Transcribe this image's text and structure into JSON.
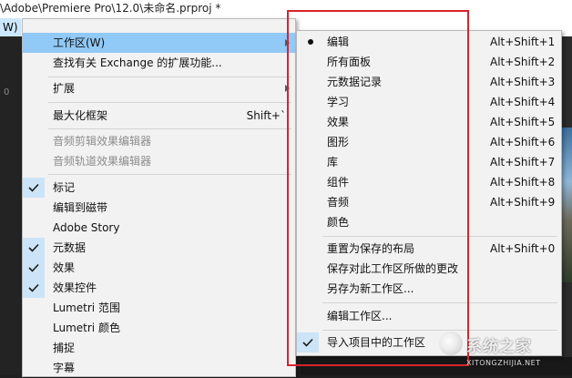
{
  "window": {
    "title": "\\Adobe\\Premiere Pro\\12.0\\未命名.prproj *",
    "menu_label": "W)"
  },
  "background": {
    "left_number": "0"
  },
  "menu": {
    "items": [
      {
        "label": "工作区(W)",
        "shortcut": "",
        "submenu": true,
        "state": "highlight"
      },
      {
        "label": "查找有关 Exchange 的扩展功能...",
        "shortcut": ""
      },
      {
        "label": "扩展",
        "shortcut": "",
        "submenu": true
      },
      {
        "label": "最大化框架",
        "shortcut": "Shift+`"
      },
      {
        "label": "音频剪辑效果编辑器",
        "disabled": true
      },
      {
        "label": "音频轨道效果编辑器",
        "disabled": true
      },
      {
        "label": "标记",
        "checked": true
      },
      {
        "label": "编辑到磁带"
      },
      {
        "label": "Adobe Story"
      },
      {
        "label": "元数据",
        "checked": true
      },
      {
        "label": "效果",
        "checked": true
      },
      {
        "label": "效果控件",
        "checked": true
      },
      {
        "label": "Lumetri 范围"
      },
      {
        "label": "Lumetri 颜色"
      },
      {
        "label": "捕捉"
      },
      {
        "label": "字幕"
      }
    ]
  },
  "submenu": {
    "items": [
      {
        "label": "编辑",
        "shortcut": "Alt+Shift+1",
        "selected": true
      },
      {
        "label": "所有面板",
        "shortcut": "Alt+Shift+2"
      },
      {
        "label": "元数据记录",
        "shortcut": "Alt+Shift+3"
      },
      {
        "label": "学习",
        "shortcut": "Alt+Shift+4"
      },
      {
        "label": "效果",
        "shortcut": "Alt+Shift+5"
      },
      {
        "label": "图形",
        "shortcut": "Alt+Shift+6"
      },
      {
        "label": "库",
        "shortcut": "Alt+Shift+7"
      },
      {
        "label": "组件",
        "shortcut": "Alt+Shift+8"
      },
      {
        "label": "音频",
        "shortcut": "Alt+Shift+9"
      },
      {
        "label": "颜色",
        "shortcut": ""
      },
      {
        "label": "重置为保存的布局",
        "shortcut": "Alt+Shift+0"
      },
      {
        "label": "保存对此工作区所做的更改",
        "shortcut": ""
      },
      {
        "label": "另存为新工作区...",
        "shortcut": ""
      },
      {
        "label": "编辑工作区...",
        "shortcut": ""
      },
      {
        "label": "导入项目中的工作区",
        "shortcut": "",
        "checked": true
      }
    ]
  },
  "watermark": {
    "text": "系统之家",
    "url": "XITONGZHIJIA.NET"
  },
  "colors": {
    "menu_bg": "#f2f2f2",
    "highlight": "#91c9f7",
    "check_bg": "#cce4f7",
    "red_box": "#d9232a",
    "disabled_text": "#8c8c8c"
  }
}
